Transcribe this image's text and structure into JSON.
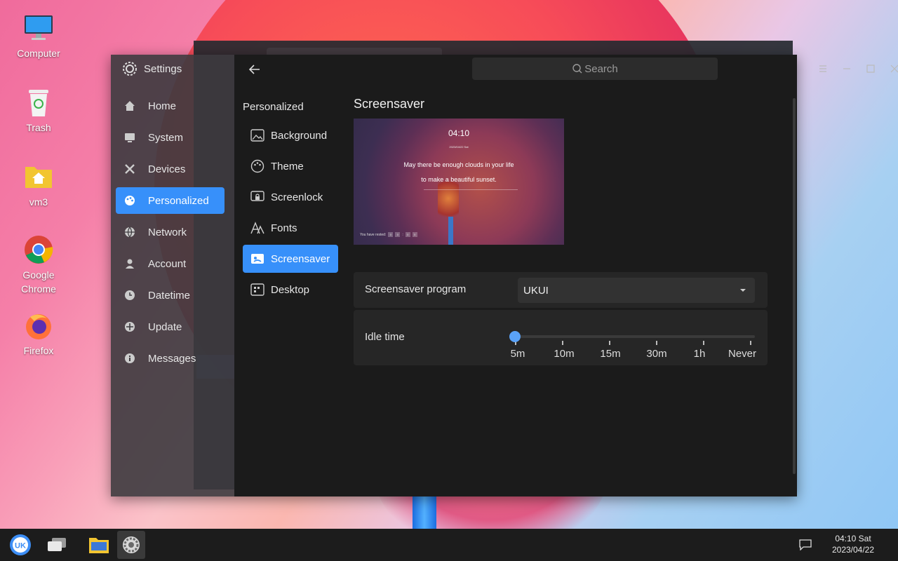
{
  "desktop": {
    "icons": [
      {
        "label": "Computer"
      },
      {
        "label": "Trash"
      },
      {
        "label": "vm3"
      },
      {
        "label": "Google\nChrome"
      },
      {
        "label": "Firefox"
      }
    ]
  },
  "settings": {
    "title": "Settings",
    "nav": [
      {
        "label": "Home",
        "icon": "home-icon"
      },
      {
        "label": "System",
        "icon": "monitor-icon"
      },
      {
        "label": "Devices",
        "icon": "tools-icon"
      },
      {
        "label": "Personalized",
        "icon": "palette-icon",
        "active": true
      },
      {
        "label": "Network",
        "icon": "globe-icon"
      },
      {
        "label": "Account",
        "icon": "user-icon"
      },
      {
        "label": "Datetime",
        "icon": "clock-icon"
      },
      {
        "label": "Update",
        "icon": "update-icon"
      },
      {
        "label": "Messages",
        "icon": "info-icon"
      }
    ],
    "search_placeholder": "Search",
    "sub_title": "Personalized",
    "sub_nav": [
      {
        "label": "Background",
        "icon": "image-icon"
      },
      {
        "label": "Theme",
        "icon": "palette-icon"
      },
      {
        "label": "Screenlock",
        "icon": "screenlock-icon"
      },
      {
        "label": "Fonts",
        "icon": "fonts-icon"
      },
      {
        "label": "Screensaver",
        "icon": "screensaver-icon",
        "active": true
      },
      {
        "label": "Desktop",
        "icon": "desktop-grid-icon"
      }
    ],
    "section_title": "Screensaver",
    "preview": {
      "time": "04:10",
      "date": "2023/04/22 Sat",
      "quote_line1": "May there be enough clouds in your life",
      "quote_line2": "to make a beautiful sunset.",
      "rest_label": "You have rested:",
      "rest_digits": [
        "0",
        "0",
        "0",
        "5"
      ]
    },
    "program": {
      "label": "Screensaver program",
      "value": "UKUI"
    },
    "idle": {
      "label": "Idle time",
      "ticks": [
        "5m",
        "10m",
        "15m",
        "30m",
        "1h",
        "Never"
      ],
      "selected": "5m"
    }
  },
  "taskbar": {
    "clock_time": "04:10 Sat",
    "clock_date": "2023/04/22"
  },
  "colors": {
    "accent": "#3790fa",
    "window_bg": "#1b1b1b"
  }
}
